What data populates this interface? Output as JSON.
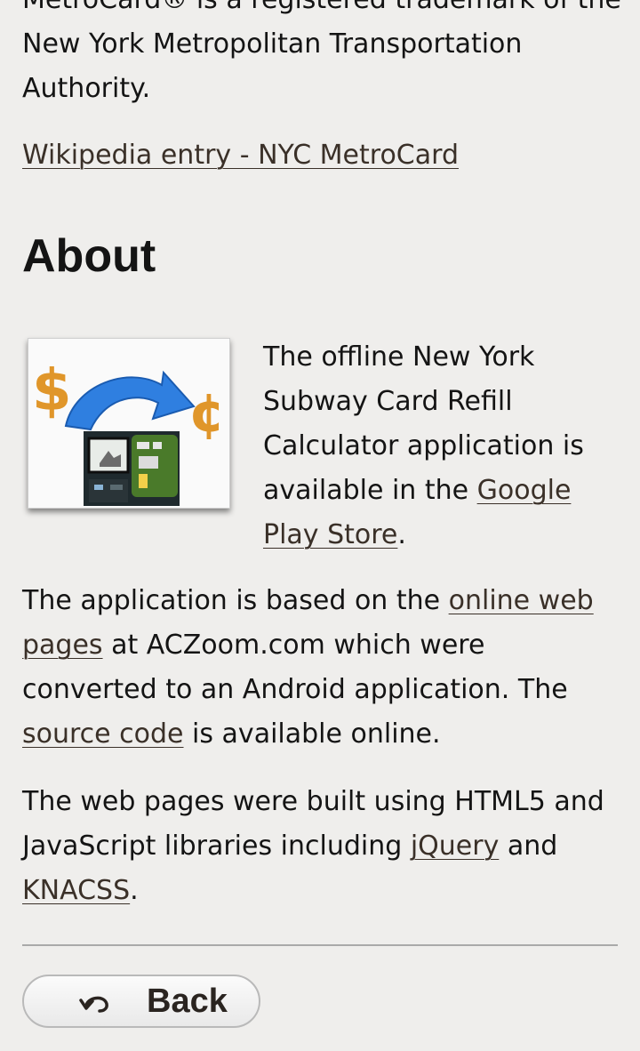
{
  "trademark": {
    "text": "MetroCard® is a registered trademark of the New York Metropolitan Transportation Authority."
  },
  "wikipedia_link": "Wikipedia entry - NYC MetroCard",
  "about": {
    "heading": "About",
    "intro": {
      "text_before": "The offline New York Subway Card Refill Calculator application is available in the ",
      "link": "Google Play Store",
      "text_after": "."
    },
    "para1": {
      "text_before": "The application is based on the ",
      "link1": "online web pages",
      "text_middle": " at ACZoom.com which were converted to an Android application. The ",
      "link2": "source code",
      "text_after": " is available online."
    },
    "para2": {
      "text_before": "The web pages were built using HTML5 and JavaScript libraries including ",
      "link1": "jQuery",
      "text_middle": " and ",
      "link2": "KNACSS",
      "text_after": "."
    }
  },
  "app_icon": {
    "name": "subway-card-refill-app-icon",
    "dollar_symbol": "$",
    "cent_symbol": "¢",
    "colors": {
      "currency": "#e0962a",
      "arrow": "#2f7fe0",
      "machine_panel": "#4a7a2a"
    }
  },
  "back_button": {
    "label": "Back",
    "icon": "back-arrow-icon"
  },
  "colors": {
    "background": "#efeeec",
    "link": "#3a3028",
    "divider": "#a9a9a9"
  }
}
